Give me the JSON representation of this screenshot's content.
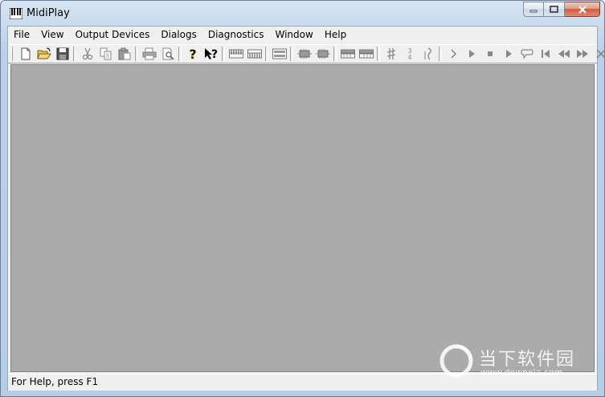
{
  "window": {
    "title": "MidiPlay"
  },
  "menu": {
    "items": [
      "File",
      "View",
      "Output Devices",
      "Dialogs",
      "Diagnostics",
      "Window",
      "Help"
    ]
  },
  "toolbar": {
    "groups": [
      [
        "new-icon",
        "open-icon",
        "save-icon"
      ],
      [
        "cut-icon",
        "copy-icon",
        "paste-icon"
      ],
      [
        "print-icon",
        "print-preview-icon"
      ],
      [
        "about-icon",
        "context-help-icon"
      ],
      [
        "keyboard-icon",
        "keyboard-alt-icon"
      ],
      [
        "channel-view-icon"
      ],
      [
        "cable-icon",
        "cable-alt-icon"
      ],
      [
        "piano-roll-icon",
        "piano-roll-alt-icon"
      ],
      [
        "sharp-icon",
        "time-signature-icon",
        "tuning-icon"
      ],
      [
        "next-icon",
        "play-icon",
        "stop-icon",
        "step-icon",
        "loop-icon",
        "rewind-start-icon",
        "rewind-icon",
        "fast-forward-icon",
        "close-file-icon"
      ]
    ]
  },
  "status": {
    "help_text": "For Help, press F1"
  },
  "watermark": {
    "cn": "当下软件园",
    "url": "www.downxia.com"
  },
  "colors": {
    "workspace": "#ababab",
    "chrome": "#f0f0f0",
    "close_button": "#cf5a40"
  }
}
